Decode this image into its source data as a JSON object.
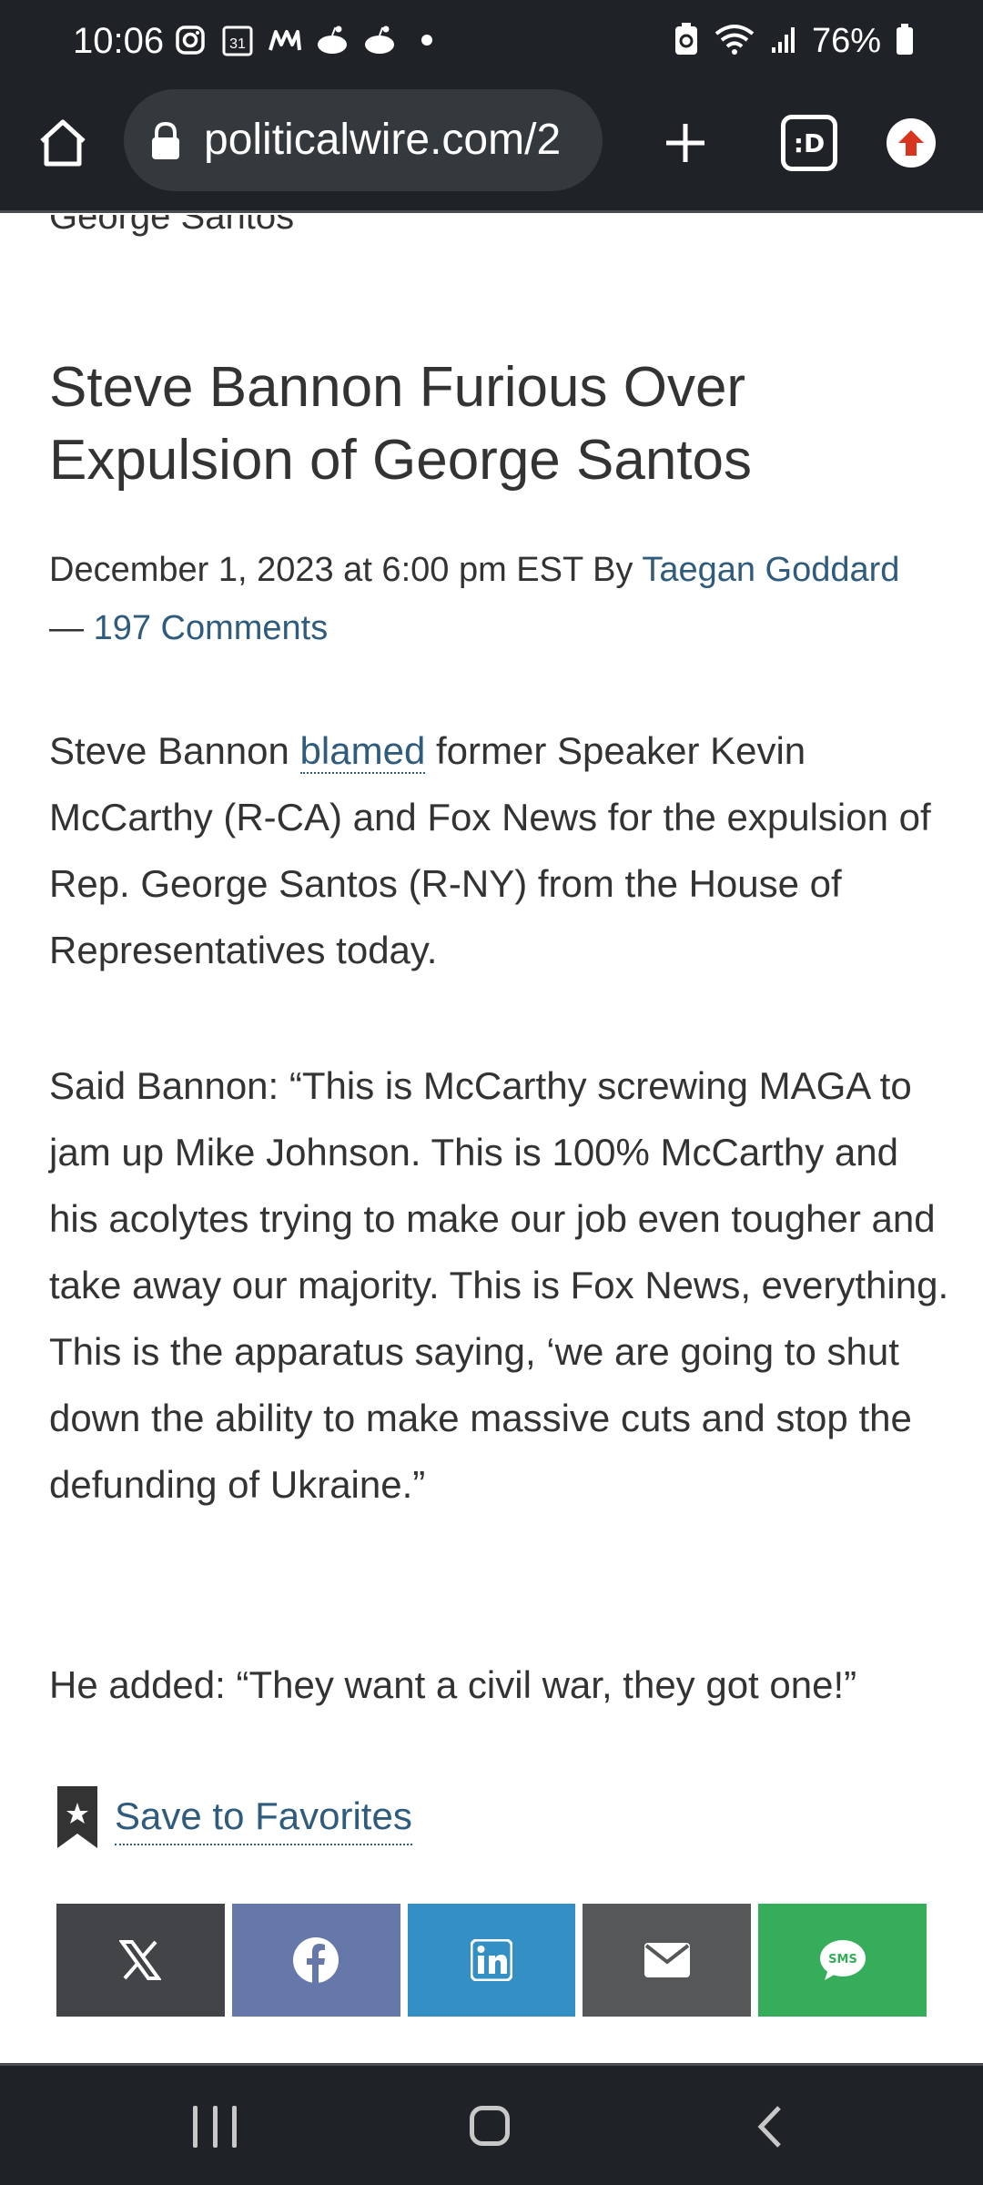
{
  "status_bar": {
    "time": "10:06",
    "battery": "76%",
    "calendar_day": "31"
  },
  "browser": {
    "url": "politicalwire.com/2",
    "tabs_label": ":D"
  },
  "article": {
    "previous_title_fragment": "George Santos",
    "title": "Steve Bannon Furious Over Expulsion of George Santos",
    "date": "December 1, 2023 at 6:00 pm EST",
    "by": "By",
    "author": "Taegan Goddard",
    "dash": "—",
    "comments": "197 Comments",
    "p1_before": "Steve Bannon",
    "p1_link": "blamed",
    "p1_after": "former Speaker Kevin McCarthy (R-CA) and Fox News for the expulsion of Rep. George Santos (R-NY) from the House of Representatives today.",
    "p2": "Said Bannon: “This is McCarthy screwing MAGA to jam up Mike Johnson. This is 100% McCarthy and his acolytes trying to make our job even tougher and take away our majority. This is Fox News, everything. This is the apparatus saying, ‘we are going to shut down the ability to make massive cuts and stop the defunding of Ukraine.”",
    "p3": "He added: “They want a civil war, they got one!”",
    "save_favorites": "Save to Favorites"
  },
  "share": {
    "sms_label": "SMS",
    "colors": {
      "x": "#424447",
      "facebook": "#6677aa",
      "linkedin": "#3490c4",
      "email": "#555759",
      "sms": "#35ad5a"
    }
  },
  "icons": [
    "instagram-icon",
    "calendar-icon",
    "app-icon",
    "reddit-icon",
    "wifi-icon",
    "signal-icon",
    "battery-icon",
    "home-icon",
    "lock-icon",
    "plus-icon",
    "tabs-icon",
    "extension-icon",
    "bookmark-star-icon",
    "x-icon",
    "facebook-icon",
    "linkedin-icon",
    "mail-icon",
    "sms-icon"
  ]
}
